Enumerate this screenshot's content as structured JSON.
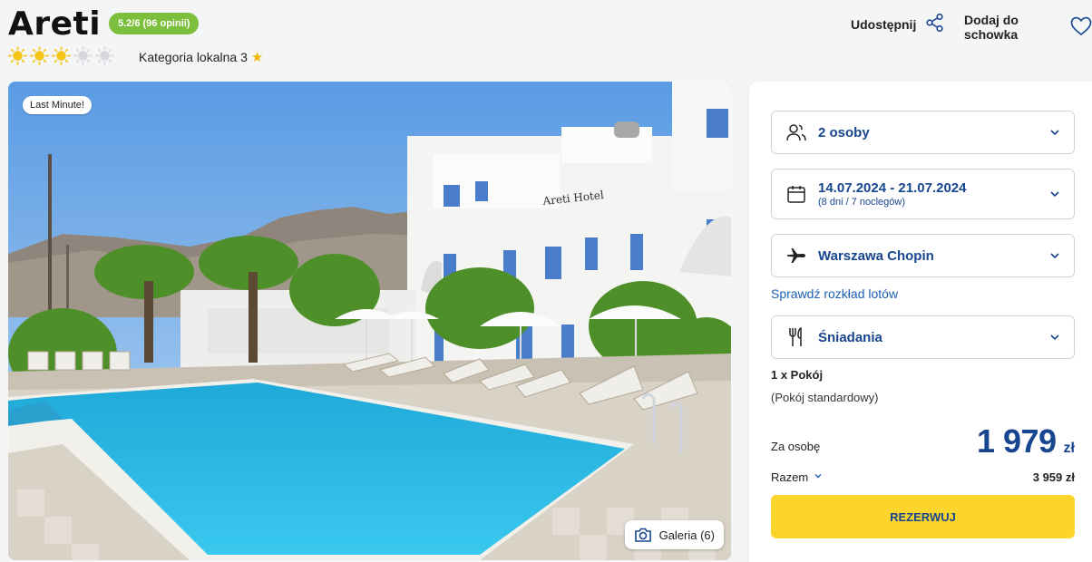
{
  "hotel": {
    "name": "Areti",
    "rating_badge": "5.2/6 (96 opinii)",
    "sun_rating": 3,
    "sun_rating_max": 5,
    "local_category_label": "Kategoria lokalna 3"
  },
  "header_actions": {
    "share_label": "Udostępnij",
    "favorite_label": "Dodaj do schowka"
  },
  "gallery": {
    "badge": "Last Minute!",
    "gallery_button": "Galeria (6)",
    "hotel_sign": "Areti Hotel"
  },
  "booking": {
    "people": "2 osoby",
    "dates": "14.07.2024 - 21.07.2024",
    "dates_sub": "(8 dni / 7 noclegów)",
    "airport": "Warszawa Chopin",
    "flight_schedule_link": "Sprawdź rozkład lotów",
    "board": "Śniadania",
    "room_count": "1 x Pokój",
    "room_type": "(Pokój standardowy)",
    "per_person_label": "Za osobę",
    "per_person_price": "1 979",
    "currency": "zł",
    "total_label": "Razem",
    "total_price": "3 959 zł",
    "book_button": "REZERWUJ"
  },
  "colors": {
    "accent_blue": "#17458f",
    "rating_green": "#7cbf3c",
    "book_yellow": "#fcd52c",
    "sun_yellow": "#f5c518"
  },
  "icons": [
    "share-icon",
    "heart-icon",
    "sun-icon",
    "star-icon",
    "people-icon",
    "calendar-icon",
    "plane-icon",
    "cutlery-icon",
    "chevron-down-icon",
    "camera-icon"
  ]
}
